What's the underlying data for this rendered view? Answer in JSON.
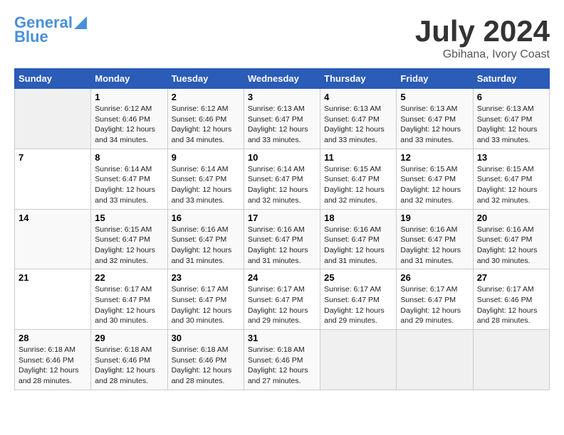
{
  "header": {
    "logo_line1": "General",
    "logo_line2": "Blue",
    "month_year": "July 2024",
    "location": "Gbihana, Ivory Coast"
  },
  "days_of_week": [
    "Sunday",
    "Monday",
    "Tuesday",
    "Wednesday",
    "Thursday",
    "Friday",
    "Saturday"
  ],
  "weeks": [
    [
      {
        "day": "",
        "info": ""
      },
      {
        "day": "1",
        "info": "Sunrise: 6:12 AM\nSunset: 6:46 PM\nDaylight: 12 hours\nand 34 minutes."
      },
      {
        "day": "2",
        "info": "Sunrise: 6:12 AM\nSunset: 6:46 PM\nDaylight: 12 hours\nand 34 minutes."
      },
      {
        "day": "3",
        "info": "Sunrise: 6:13 AM\nSunset: 6:47 PM\nDaylight: 12 hours\nand 33 minutes."
      },
      {
        "day": "4",
        "info": "Sunrise: 6:13 AM\nSunset: 6:47 PM\nDaylight: 12 hours\nand 33 minutes."
      },
      {
        "day": "5",
        "info": "Sunrise: 6:13 AM\nSunset: 6:47 PM\nDaylight: 12 hours\nand 33 minutes."
      },
      {
        "day": "6",
        "info": "Sunrise: 6:13 AM\nSunset: 6:47 PM\nDaylight: 12 hours\nand 33 minutes."
      }
    ],
    [
      {
        "day": "7",
        "info": ""
      },
      {
        "day": "8",
        "info": "Sunrise: 6:14 AM\nSunset: 6:47 PM\nDaylight: 12 hours\nand 33 minutes."
      },
      {
        "day": "9",
        "info": "Sunrise: 6:14 AM\nSunset: 6:47 PM\nDaylight: 12 hours\nand 33 minutes."
      },
      {
        "day": "10",
        "info": "Sunrise: 6:14 AM\nSunset: 6:47 PM\nDaylight: 12 hours\nand 32 minutes."
      },
      {
        "day": "11",
        "info": "Sunrise: 6:15 AM\nSunset: 6:47 PM\nDaylight: 12 hours\nand 32 minutes."
      },
      {
        "day": "12",
        "info": "Sunrise: 6:15 AM\nSunset: 6:47 PM\nDaylight: 12 hours\nand 32 minutes."
      },
      {
        "day": "13",
        "info": "Sunrise: 6:15 AM\nSunset: 6:47 PM\nDaylight: 12 hours\nand 32 minutes."
      }
    ],
    [
      {
        "day": "14",
        "info": ""
      },
      {
        "day": "15",
        "info": "Sunrise: 6:15 AM\nSunset: 6:47 PM\nDaylight: 12 hours\nand 32 minutes."
      },
      {
        "day": "16",
        "info": "Sunrise: 6:16 AM\nSunset: 6:47 PM\nDaylight: 12 hours\nand 31 minutes."
      },
      {
        "day": "17",
        "info": "Sunrise: 6:16 AM\nSunset: 6:47 PM\nDaylight: 12 hours\nand 31 minutes."
      },
      {
        "day": "18",
        "info": "Sunrise: 6:16 AM\nSunset: 6:47 PM\nDaylight: 12 hours\nand 31 minutes."
      },
      {
        "day": "19",
        "info": "Sunrise: 6:16 AM\nSunset: 6:47 PM\nDaylight: 12 hours\nand 31 minutes."
      },
      {
        "day": "20",
        "info": "Sunrise: 6:16 AM\nSunset: 6:47 PM\nDaylight: 12 hours\nand 30 minutes."
      }
    ],
    [
      {
        "day": "21",
        "info": ""
      },
      {
        "day": "22",
        "info": "Sunrise: 6:17 AM\nSunset: 6:47 PM\nDaylight: 12 hours\nand 30 minutes."
      },
      {
        "day": "23",
        "info": "Sunrise: 6:17 AM\nSunset: 6:47 PM\nDaylight: 12 hours\nand 30 minutes."
      },
      {
        "day": "24",
        "info": "Sunrise: 6:17 AM\nSunset: 6:47 PM\nDaylight: 12 hours\nand 29 minutes."
      },
      {
        "day": "25",
        "info": "Sunrise: 6:17 AM\nSunset: 6:47 PM\nDaylight: 12 hours\nand 29 minutes."
      },
      {
        "day": "26",
        "info": "Sunrise: 6:17 AM\nSunset: 6:47 PM\nDaylight: 12 hours\nand 29 minutes."
      },
      {
        "day": "27",
        "info": "Sunrise: 6:17 AM\nSunset: 6:46 PM\nDaylight: 12 hours\nand 28 minutes."
      }
    ],
    [
      {
        "day": "28",
        "info": "Sunrise: 6:18 AM\nSunset: 6:46 PM\nDaylight: 12 hours\nand 28 minutes."
      },
      {
        "day": "29",
        "info": "Sunrise: 6:18 AM\nSunset: 6:46 PM\nDaylight: 12 hours\nand 28 minutes."
      },
      {
        "day": "30",
        "info": "Sunrise: 6:18 AM\nSunset: 6:46 PM\nDaylight: 12 hours\nand 28 minutes."
      },
      {
        "day": "31",
        "info": "Sunrise: 6:18 AM\nSunset: 6:46 PM\nDaylight: 12 hours\nand 27 minutes."
      },
      {
        "day": "",
        "info": ""
      },
      {
        "day": "",
        "info": ""
      },
      {
        "day": "",
        "info": ""
      }
    ]
  ]
}
